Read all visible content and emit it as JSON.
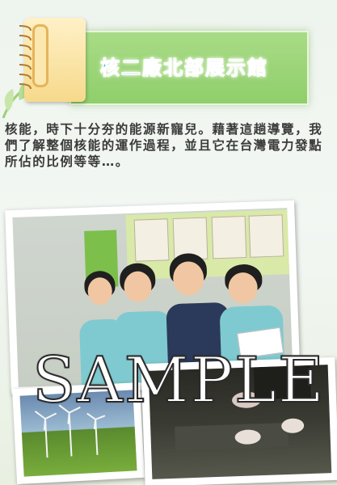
{
  "header": {
    "title": "核二廠北部展示館"
  },
  "intro": {
    "text": "核能，時下十分夯的能源新寵兒。藉著這趟導覽，我們了解整個核能的運作過程，並且它在台灣電力發點所佔的比例等等…。"
  },
  "photos": {
    "main": "group-photo",
    "wind": "wind-turbines-photo",
    "feet": "feet-photo"
  },
  "watermark": {
    "text": "SAMPLE"
  },
  "colors": {
    "title": "#3a9ad6",
    "title_band": "#8fcf6b",
    "notepad": "#f6d98b",
    "text": "#3a3a3a"
  }
}
